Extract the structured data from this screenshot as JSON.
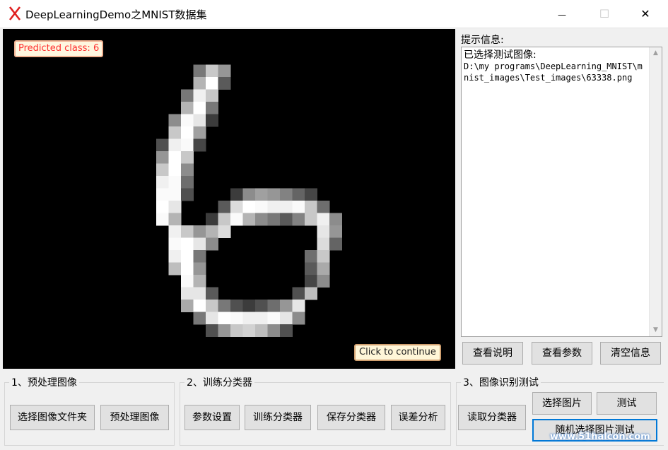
{
  "window": {
    "title": "DeepLearningDemo之MNIST数据集",
    "minimize_glyph": "—",
    "maximize_glyph": "☐",
    "close_glyph": "✕"
  },
  "canvas": {
    "predicted_label": "Predicted class: 6",
    "continue_label": "Click to continue"
  },
  "info": {
    "heading": "提示信息:",
    "first_line": "已选择测试图像:",
    "path_lines": "D:\\my programs\\DeepLearning_MNIST\\mnist_images\\Test_images\\63338.png"
  },
  "right_buttons": {
    "view_help": "查看说明",
    "view_params": "查看参数",
    "clear_info": "清空信息"
  },
  "group1": {
    "title": "1、预处理图像",
    "select_folder": "选择图像文件夹",
    "preprocess": "预处理图像"
  },
  "group2": {
    "title": "2、训练分类器",
    "param_settings": "参数设置",
    "train": "训练分类器",
    "save": "保存分类器",
    "error_analysis": "误差分析"
  },
  "group3": {
    "title": "3、图像识别测试",
    "read_classifier": "读取分类器",
    "select_image": "选择图片",
    "test": "测试",
    "random_test": "随机选择图片测试"
  },
  "watermark": "www.51halcon.com",
  "colors": {
    "canvas_bg": "#000000",
    "predicted_text": "#ff3030",
    "focus_border": "#0078d7"
  }
}
